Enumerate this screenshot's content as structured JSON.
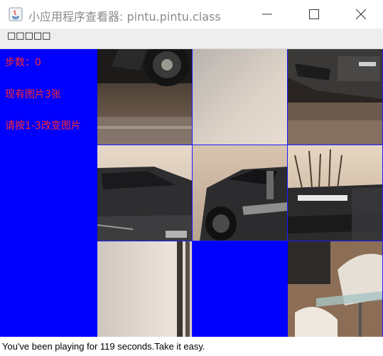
{
  "window": {
    "title": "小应用程序查看器: pintu.pintu.class"
  },
  "menu": {
    "label": "□□□□□"
  },
  "side_panel": {
    "steps_label": "步数：0",
    "image_count_label": "现有图片3张",
    "instruction_label": "请按1-3改变图片",
    "background_color": "#0000ff",
    "text_color": "#ff2a2a"
  },
  "puzzle": {
    "rows": 3,
    "columns": 3,
    "empty_tile_position": "row 3, column 2"
  },
  "status": {
    "message": "You've been playing for 119 seconds.Take it easy."
  }
}
